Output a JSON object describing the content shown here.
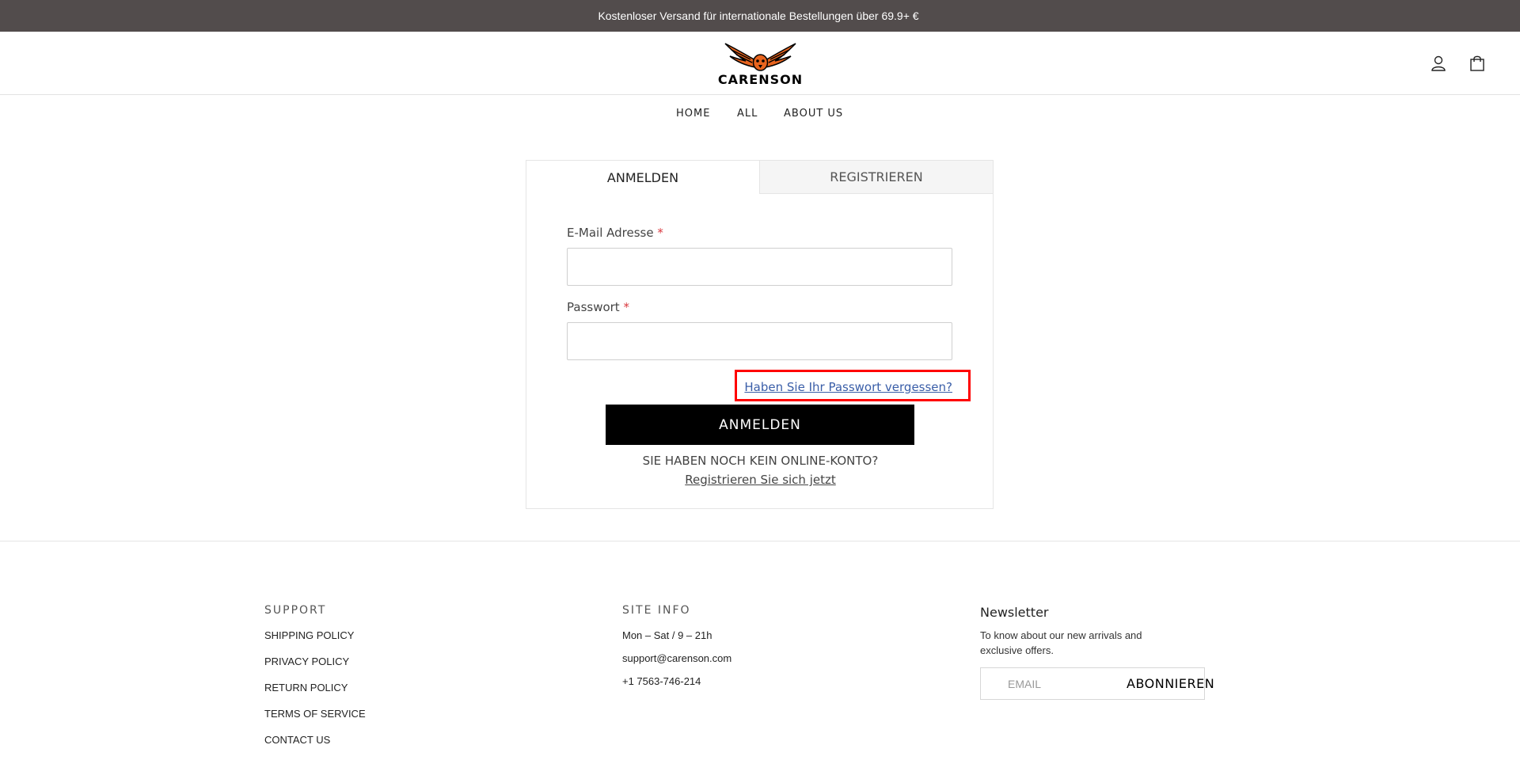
{
  "promo": {
    "text": "Kostenloser Versand für internationale Bestellungen über 69.9+ €"
  },
  "header": {
    "logo_text": "CARENSON",
    "icons": {
      "account": "user-icon",
      "cart": "shopping-bag-icon"
    }
  },
  "nav": {
    "items": [
      {
        "label": "HOME"
      },
      {
        "label": "ALL"
      },
      {
        "label": "ABOUT US"
      }
    ]
  },
  "login": {
    "tabs": [
      {
        "label": "ANMELDEN",
        "active": true
      },
      {
        "label": "REGISTRIEREN",
        "active": false
      }
    ],
    "email_label": "E-Mail Adresse",
    "password_label": "Passwort",
    "required_marker": "*",
    "email_value": "",
    "password_value": "",
    "forgot_password": "Haben Sie Ihr Passwort vergessen?",
    "submit_label": "ANMELDEN",
    "no_account_text": "SIE HABEN NOCH KEIN ONLINE-KONTO?",
    "register_link": "Registrieren Sie sich jetzt"
  },
  "footer": {
    "support": {
      "heading": "SUPPORT",
      "links": [
        {
          "label": "SHIPPING POLICY"
        },
        {
          "label": "PRIVACY POLICY"
        },
        {
          "label": "RETURN POLICY"
        },
        {
          "label": "TERMS OF SERVICE"
        },
        {
          "label": "CONTACT US"
        }
      ]
    },
    "site_info": {
      "heading": "SITE INFO",
      "hours": "Mon – Sat / 9 – 21h",
      "email": "support@carenson.com",
      "phone": "+1 7563-746-214"
    },
    "newsletter": {
      "title": "Newsletter",
      "description": "To know about our new arrivals and exclusive offers.",
      "email_placeholder": "EMAIL",
      "button_label": "ABONNIEREN"
    }
  },
  "colors": {
    "promo_bg": "#524c4c",
    "highlight_border": "#ff0000",
    "link_blue": "#3a5ea8",
    "required_red": "#d9383e",
    "logo_orange": "#e8641e"
  }
}
